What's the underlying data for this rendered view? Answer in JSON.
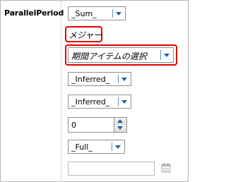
{
  "function_name": "ParallelPeriod",
  "fields": {
    "aggregate": {
      "value": "_Sum_"
    },
    "measure": {
      "value": "メジャー"
    },
    "hierarchy": {
      "value": "期間アイテムの選択"
    },
    "level1": {
      "value": "_Inferred_"
    },
    "level2": {
      "value": "_Inferred_"
    },
    "offset": {
      "value": "0"
    },
    "mode": {
      "value": "_Full_"
    },
    "date": {
      "value": ""
    }
  },
  "icons": {
    "dropdown": "chevron-down-icon",
    "spinner_up": "up-arrow-icon",
    "spinner_down": "down-arrow-icon",
    "calendar": "calendar-icon"
  },
  "colors": {
    "highlight_border": "#e00000",
    "arrow": "#1f5f99"
  }
}
